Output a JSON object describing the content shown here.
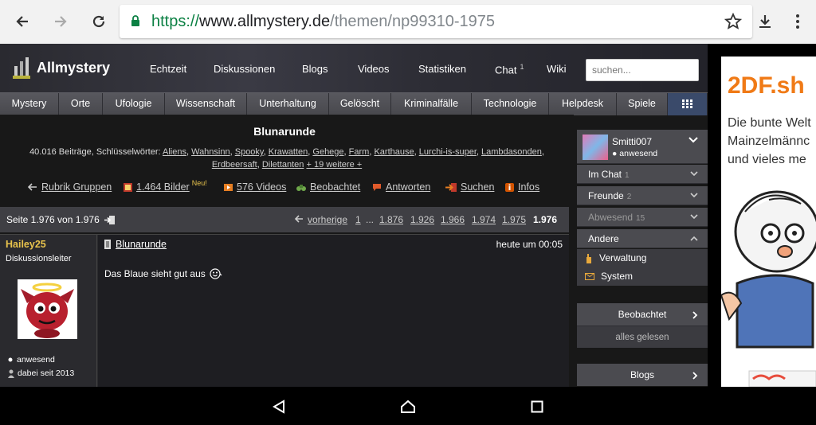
{
  "browser": {
    "url_scheme": "https://",
    "url_host": "www.allmystery.de",
    "url_path": "/themen/np99310-1975"
  },
  "site": {
    "logo": "Allmystery",
    "top_nav": [
      {
        "label": "Echtzeit"
      },
      {
        "label": "Diskussionen"
      },
      {
        "label": "Blogs"
      },
      {
        "label": "Videos"
      },
      {
        "label": "Statistiken"
      },
      {
        "label": "Chat",
        "badge": "1"
      },
      {
        "label": "Wiki"
      }
    ],
    "search_placeholder": "suchen...",
    "categories": [
      "Mystery",
      "Orte",
      "Ufologie",
      "Wissenschaft",
      "Unterhaltung",
      "Gelöscht",
      "Kriminalfälle",
      "Technologie",
      "Helpdesk",
      "Spiele"
    ]
  },
  "thread": {
    "title": "Blunarunde",
    "stats_prefix": "40.016 Beiträge, Schlüsselwörter:",
    "keywords": [
      "Aliens",
      "Wahnsinn",
      "Spooky",
      "Krawatten",
      "Gehege",
      "Farm",
      "Karthause",
      "Lurchi-is-super",
      "Lambdasonden",
      "Erdbeersaft",
      "Dilettanten"
    ],
    "more_keywords": "+ 19 weitere +",
    "actions": {
      "group": "Rubrik Gruppen",
      "images": "1.464 Bilder",
      "images_badge": "Neu!",
      "videos": "576 Videos",
      "watched": "Beobachtet",
      "answers": "Antworten",
      "search": "Suchen",
      "info": "Infos"
    }
  },
  "pager": {
    "page_info": "Seite 1.976 von 1.976",
    "prev": "vorherige",
    "first": "1",
    "ellipsis": "...",
    "pages": [
      "1.876",
      "1.926",
      "1.966",
      "1.974",
      "1.975"
    ],
    "current": "1.976"
  },
  "post": {
    "author": "Hailey25",
    "role": "Diskussionsleiter",
    "status": "anwesend",
    "since": "dabei seit 2013",
    "title": "Blunarunde",
    "time": "heute um 00:05",
    "text": "Das Blaue sieht gut aus"
  },
  "sidebar": {
    "user": "Smitti007",
    "user_status": "● anwesend",
    "chat": {
      "label": "Im Chat",
      "count": "1"
    },
    "friends": {
      "label": "Freunde",
      "count": "2"
    },
    "absent": {
      "label": "Abwesend",
      "count": "15"
    },
    "other": "Andere",
    "admin": "Verwaltung",
    "system": "System",
    "watched": "Beobachtet",
    "all_read": "alles gelesen",
    "blogs": "Blogs"
  },
  "ad": {
    "logo": "2DF.sh",
    "lines": [
      "Die bunte Welt",
      "Mainzelmännc",
      "und vieles me"
    ]
  }
}
